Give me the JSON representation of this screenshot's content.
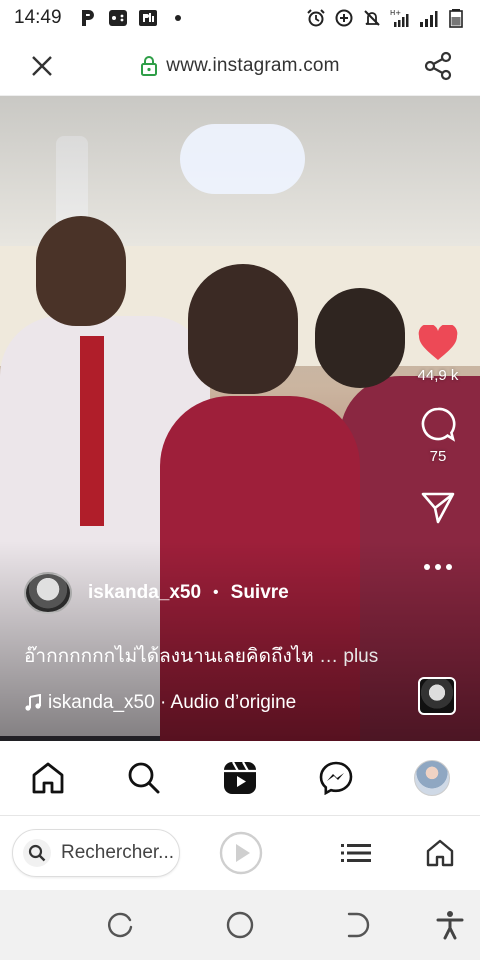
{
  "status_bar": {
    "time": "14:49",
    "left_icons": [
      "p-icon",
      "gamepad-icon",
      "pl-icon",
      "dot-icon"
    ],
    "right_icons": [
      "alarm-icon",
      "data-saver-icon",
      "mute-icon",
      "signal-h-plus-icon",
      "signal-icon",
      "battery-icon"
    ]
  },
  "browser": {
    "url": "www.instagram.com",
    "search_placeholder": "Rechercher..."
  },
  "reel": {
    "likes": "44,9 k",
    "comments": "75",
    "author": "iskanda_x50",
    "separator": "•",
    "follow_label": "Suivre",
    "caption_text": "อ๊ากกกกกกไม่ได้ลงนานเลยคิดถึงไห",
    "caption_more": "… plus",
    "audio_text": "iskanda_x50 · Audio d’origine"
  },
  "colors": {
    "like_red": "#ed4956",
    "text_dark": "#222222",
    "lock_green": "#2e9e47"
  },
  "ig_nav": [
    "home-icon",
    "search-icon",
    "reels-icon",
    "messenger-icon",
    "profile-avatar"
  ]
}
